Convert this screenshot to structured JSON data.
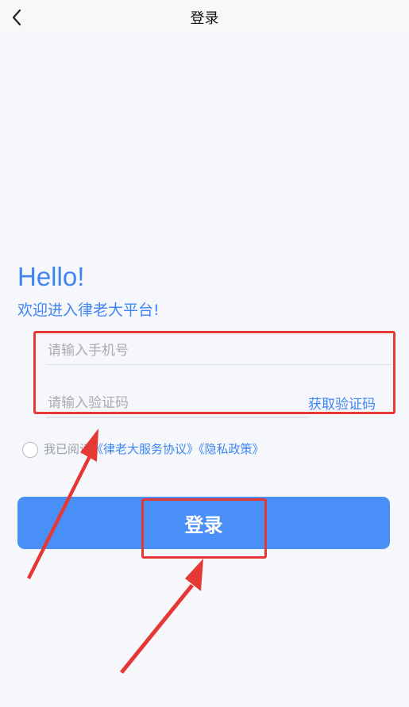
{
  "nav": {
    "title": "登录",
    "back_icon": "chevron-left-icon"
  },
  "greeting": {
    "hello": "Hello!",
    "welcome": "欢迎进入律老大平台!"
  },
  "form": {
    "phone_placeholder": "请输入手机号",
    "code_placeholder": "请输入验证码",
    "get_code_label": "获取验证码"
  },
  "agreement": {
    "prefix": "我已阅读",
    "service_link": "《律老大服务协议》",
    "privacy_link": "《隐私政策》"
  },
  "login_button": {
    "label": "登录"
  },
  "colors": {
    "accent": "#3f86f3",
    "button": "#4a8ef7",
    "annotation": "#e53935"
  }
}
